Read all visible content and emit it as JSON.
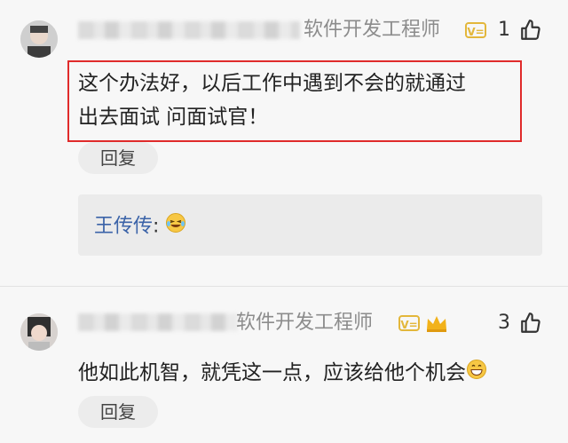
{
  "comments": [
    {
      "user_title": "软件开发工程师",
      "like_count": "1",
      "text_line1": "这个办法好，以后工作中遇到不会的就通过",
      "text_line2": "出去面试 问面试官！",
      "reply_label": "回复",
      "sub_reply": {
        "author": "王传传",
        "separator": ":"
      }
    },
    {
      "user_title": "软件开发工程师",
      "like_count": "3",
      "text": "他如此机智，就凭这一点，应该给他个机会",
      "reply_label": "回复"
    }
  ],
  "icons": {
    "like": "thumbs-up-icon",
    "level_badge": "level-badge-icon",
    "crown": "crown-icon",
    "laugh_emoji": "laughing-tears-emoji",
    "grin_emoji": "grinning-emoji"
  },
  "colors": {
    "highlight_border": "#e02b2b",
    "author_link": "#3b63a8",
    "badge_gold": "#e3b73b"
  }
}
